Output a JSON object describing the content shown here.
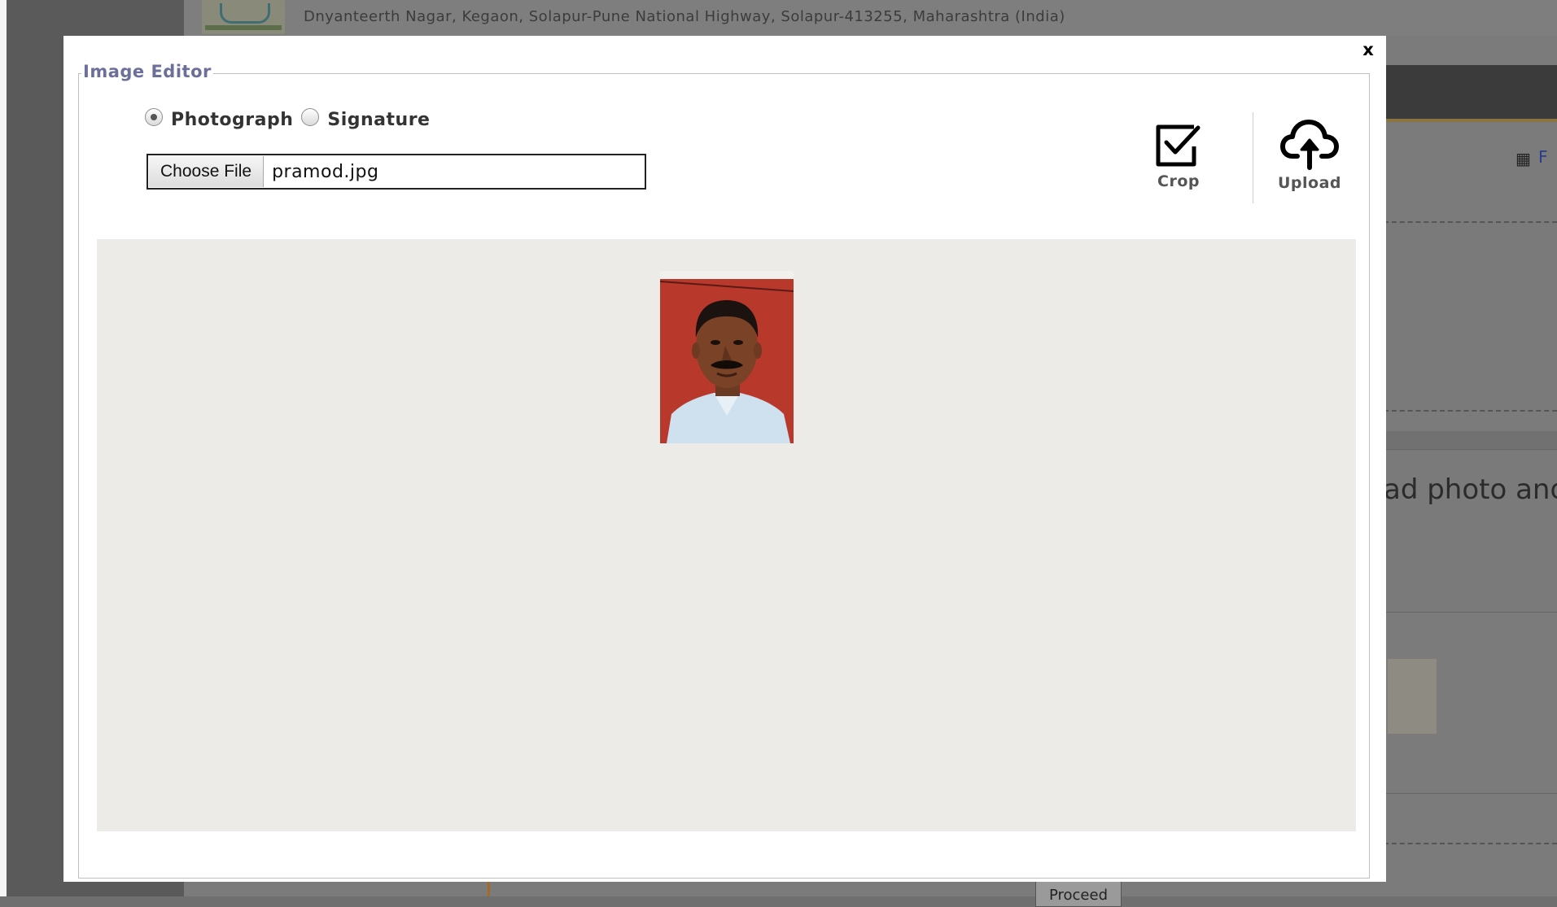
{
  "background": {
    "address": "Dnyanteerth Nagar, Kegaon, Solapur-Pune National Highway, Solapur-413255, Maharashtra (India)",
    "note_fragment": "ad photo and",
    "proceed_fragment": "Proceed",
    "grid_letter": "F"
  },
  "modal": {
    "close_label": "x",
    "legend": "Image Editor",
    "radios": [
      {
        "label": "Photograph",
        "checked": true
      },
      {
        "label": "Signature",
        "checked": false
      }
    ],
    "file": {
      "button_label": "Choose File",
      "file_name": "pramod.jpg"
    },
    "tools": {
      "crop_label": "Crop",
      "upload_label": "Upload"
    }
  },
  "icons": [
    "crop-check-icon",
    "upload-cloud-icon",
    "grid-icon"
  ],
  "colors": {
    "legend": "#6b6f99",
    "canvas": "#ecebe7",
    "photo_background": "#b8382c"
  }
}
